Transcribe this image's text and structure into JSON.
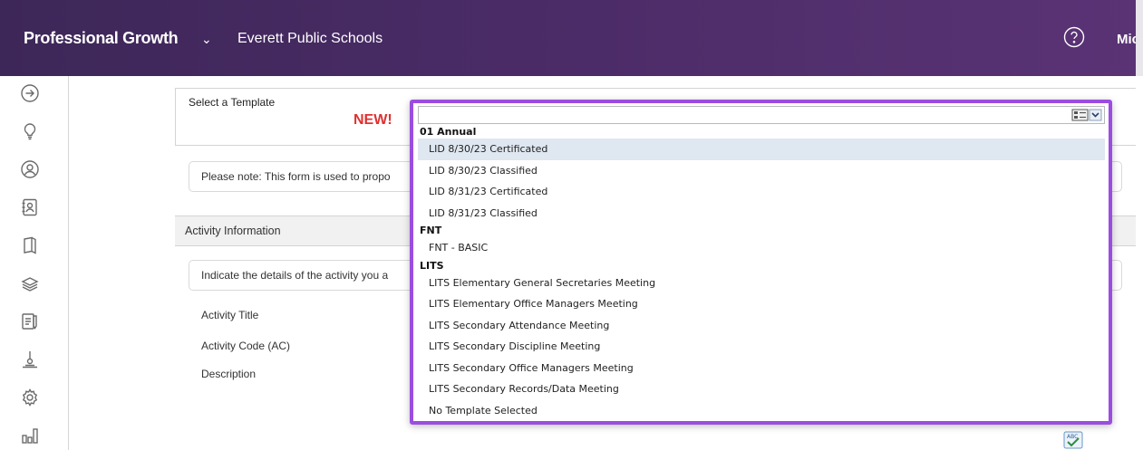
{
  "header": {
    "app_title": "Professional Growth",
    "app_chevron": "⌄",
    "district": "Everett Public Schools",
    "help_icon": "help-circle-icon",
    "user_name": "Mic"
  },
  "sidebar": {
    "icons": [
      "arrow-right-circle-icon",
      "lightbulb-icon",
      "person-circle-icon",
      "contacts-book-icon",
      "book-icon",
      "layers-icon",
      "document-edit-icon",
      "certificate-award-icon",
      "gear-icon",
      "bar-chart-icon"
    ]
  },
  "form": {
    "select_template_label": "Select a Template",
    "new_badge": "NEW!",
    "note_text": "Please note: This form is used to propo",
    "section_title": "Activity Information",
    "indicate_text": "Indicate the details of the activity you a",
    "fields": {
      "activity_title": "Activity Title",
      "activity_code": "Activity Code (AC)",
      "description": "Description"
    },
    "spellcheck_icon": "spellcheck-icon"
  },
  "dropdown": {
    "current_value": "",
    "button_icon": "list-dropdown-icon",
    "groups": [
      {
        "label": "01 Annual",
        "options": [
          "LID 8/30/23 Certificated",
          "LID 8/30/23 Classified",
          "LID 8/31/23 Certificated",
          "LID 8/31/23 Classified"
        ]
      },
      {
        "label": "FNT",
        "options": [
          "FNT - BASIC"
        ]
      },
      {
        "label": "LITS",
        "options": [
          "LITS Elementary General Secretaries Meeting",
          "LITS Elementary Office Managers Meeting",
          "LITS Secondary Attendance Meeting",
          "LITS Secondary Discipline Meeting",
          "LITS Secondary Office Managers Meeting",
          "LITS Secondary Records/Data Meeting",
          "No Template Selected"
        ]
      }
    ],
    "highlighted_option": "LID 8/30/23 Certificated",
    "accent_color": "#9b4de0"
  },
  "colors": {
    "header_start": "#3d2758",
    "header_end": "#5a3375",
    "new_badge": "#e03030"
  }
}
